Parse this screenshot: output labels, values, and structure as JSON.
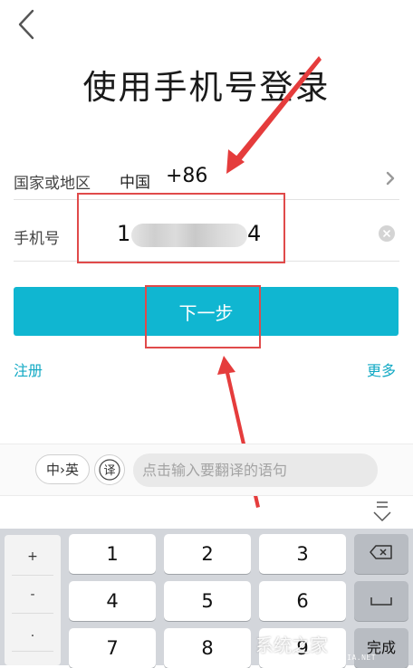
{
  "page": {
    "title": "使用手机号登录"
  },
  "form": {
    "region_label": "国家或地区",
    "country_name": "中国",
    "country_code": "+86",
    "phone_label": "手机号",
    "phone_prefix": "1",
    "phone_suffix": "4"
  },
  "actions": {
    "next_label": "下一步",
    "register_label": "注册",
    "more_label": "更多"
  },
  "translate_bar": {
    "lang_toggle": "中›英",
    "mode_label": "译",
    "placeholder": "点击输入要翻译的语句"
  },
  "keyboard": {
    "symbols": [
      "+",
      "-",
      "."
    ],
    "keys": [
      "1",
      "2",
      "3",
      "4",
      "5",
      "6",
      "7",
      "8",
      "9"
    ],
    "done_label": "完成"
  },
  "watermark": {
    "text": "系统之家",
    "url": "XITONGZHIJIA.NET"
  },
  "colors": {
    "accent": "#10b6d1",
    "link": "#12a9c4",
    "annotation": "#e04a4a",
    "keyboard_bg": "#d3d6db"
  }
}
